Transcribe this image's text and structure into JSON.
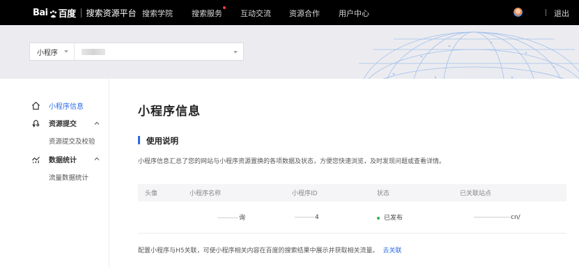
{
  "topbar": {
    "logo_left": "Bai",
    "logo_right": "百度",
    "platform_title": "搜索资源平台",
    "nav": [
      {
        "label": "搜索学院"
      },
      {
        "label": "搜索服务",
        "has_dot": true
      },
      {
        "label": "互动交流"
      },
      {
        "label": "资源合作"
      },
      {
        "label": "用户中心"
      }
    ],
    "logout": "退出"
  },
  "selector": {
    "type_label": "小程序"
  },
  "sidebar": {
    "items": [
      {
        "label": "小程序信息",
        "icon": "home-icon",
        "active": true
      },
      {
        "label": "资源提交",
        "icon": "resource-submit-icon",
        "expanded": true,
        "children": [
          {
            "label": "资源提交及校验"
          }
        ]
      },
      {
        "label": "数据统计",
        "icon": "data-stats-icon",
        "expanded": true,
        "children": [
          {
            "label": "流量数据统计"
          }
        ]
      }
    ]
  },
  "main": {
    "title": "小程序信息",
    "section_title": "使用说明",
    "description": "小程序信息汇总了您的网站与小程序资源置换的各项数据及状态，方便您快速浏览，及时发现问题或查看详情。",
    "table": {
      "headers": [
        "头像",
        "小程序名称",
        "小程序ID",
        "状态",
        "已关联站点"
      ],
      "rows": [
        {
          "avatar": "",
          "name_visible": "询",
          "id_visible": "4",
          "status": "已发布",
          "site_visible": "cn/"
        }
      ]
    },
    "footer_note": "配置小程序与H5关联，可使小程序相关内容在百度的搜索结果中展示并获取相关流量。",
    "footer_link": "去关联"
  },
  "colors": {
    "topbar_bg": "#000000",
    "accent": "#2b6be6",
    "status_published": "#2bb24c",
    "banner_bg": "#ececf0"
  }
}
